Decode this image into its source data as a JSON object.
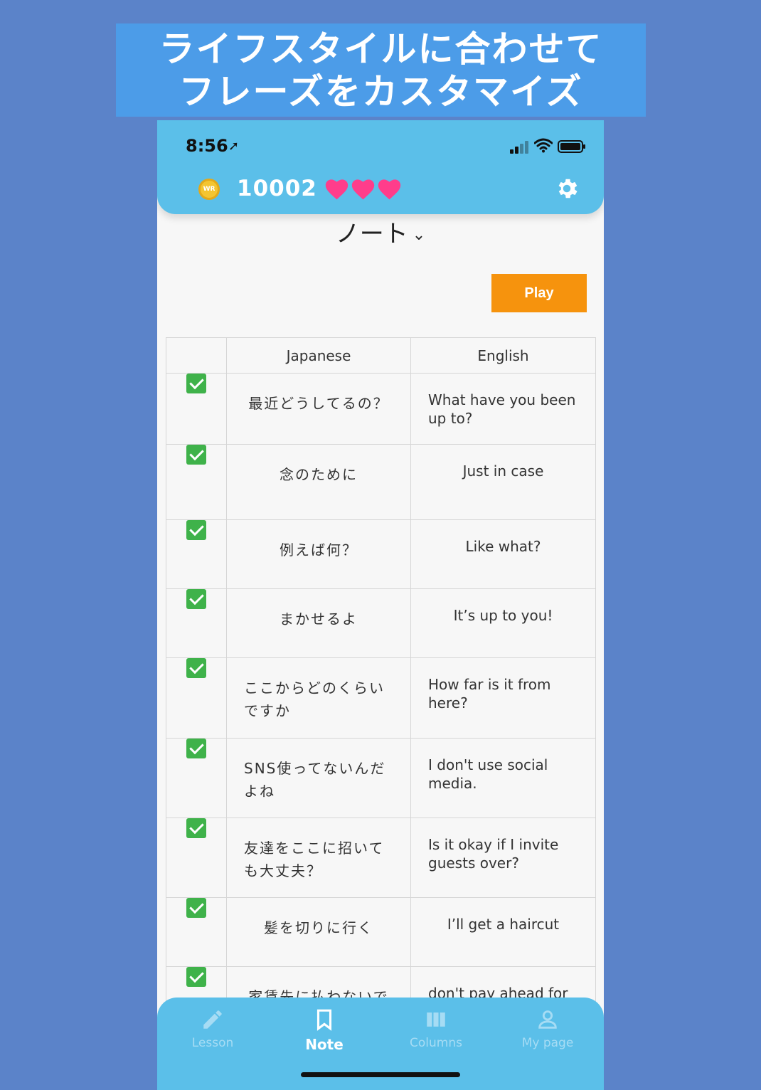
{
  "banner": {
    "line1": "ライフスタイルに合わせて",
    "line2": "フレーズをカスタマイズ"
  },
  "status_bar": {
    "time": "8:56"
  },
  "header": {
    "coin_count": "10002",
    "coin_label": "WR",
    "hearts": 3,
    "heart_color": "#ff3d8b"
  },
  "page": {
    "title": "ノート",
    "play_label": "Play"
  },
  "table": {
    "headers": [
      "",
      "Japanese",
      "English"
    ],
    "rows": [
      {
        "checked": true,
        "japanese": "最近どうしてるの？",
        "english": "What have you been up to?"
      },
      {
        "checked": true,
        "japanese": "念のために",
        "english": "Just in case"
      },
      {
        "checked": true,
        "japanese": "例えば何？",
        "english": "Like what?"
      },
      {
        "checked": true,
        "japanese": "まかせるよ",
        "english": "It’s up to you!"
      },
      {
        "checked": true,
        "japanese": "ここからどのくらいですか",
        "english": "How far is it from here?"
      },
      {
        "checked": true,
        "japanese": "SNS使ってないんだよね",
        "english": "I don't use social media."
      },
      {
        "checked": true,
        "japanese": "友達をここに招いても大丈夫？",
        "english": "Is it okay if I invite guests over?"
      },
      {
        "checked": true,
        "japanese": "髪を切りに行く",
        "english": "I’ll get a haircut"
      },
      {
        "checked": true,
        "japanese": "家賃先に払わないで",
        "english": "don't pay ahead for"
      }
    ]
  },
  "tabbar": {
    "tabs": [
      {
        "label": "Lesson",
        "icon": "pencil-icon"
      },
      {
        "label": "Note",
        "icon": "bookmark-icon"
      },
      {
        "label": "Columns",
        "icon": "columns-icon"
      },
      {
        "label": "My page",
        "icon": "person-icon"
      }
    ]
  },
  "colors": {
    "header": "#5bbfe9",
    "background": "#5b83c9",
    "banner": "#4c9ce8",
    "play": "#f6930d",
    "check": "#3fb24a"
  }
}
